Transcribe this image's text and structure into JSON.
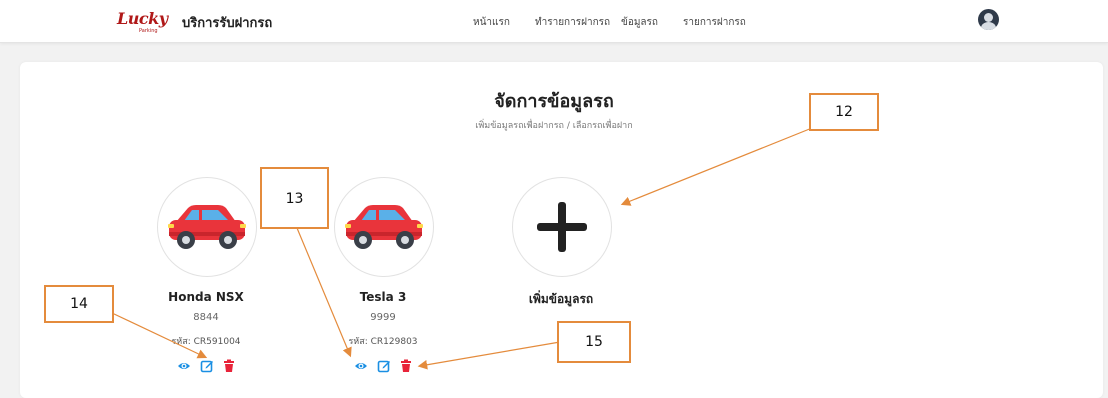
{
  "nav": {
    "logo_text": "Lucky",
    "logo_sub": "Parking",
    "brand_name": "บริการรับฝากรถ",
    "links": [
      "หน้าแรก",
      "ทำรายการฝากรถ",
      "ข้อมูลรถ",
      "รายการฝากรถ"
    ]
  },
  "page": {
    "title": "จัดการข้อมูลรถ",
    "subtitle": "เพิ่มข้อมูลรถเพื่อฝากรถ / เลือกรถเพื่อฝาก"
  },
  "vehicles": [
    {
      "name": "Honda NSX",
      "plate": "8844",
      "code": "รหัส: CR591004"
    },
    {
      "name": "Tesla 3",
      "plate": "9999",
      "code": "รหัส: CR129803"
    }
  ],
  "add_vehicle": {
    "label": "เพิ่มข้อมูลรถ"
  },
  "callouts": [
    "12",
    "13",
    "14",
    "15"
  ],
  "icons": {
    "view": "eye-icon",
    "edit": "edit-icon",
    "delete": "trash-icon",
    "vehicle": "car-icon",
    "add": "plus-icon",
    "profile": "user-avatar-icon"
  },
  "colors": {
    "accent": "#1a8fe3",
    "danger": "#e8243a",
    "car": "#e9343b",
    "callout_border": "#e48b3c",
    "arrow": "#e48b3c"
  }
}
